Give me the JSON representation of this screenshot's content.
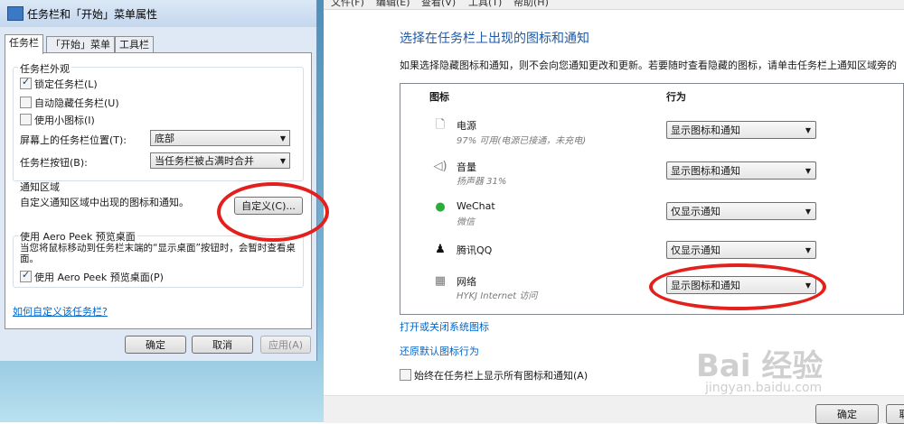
{
  "dialog": {
    "title": "任务栏和「开始」菜单属性",
    "tabs": [
      "任务栏",
      "「开始」菜单",
      "工具栏"
    ],
    "appearance": {
      "title": "任务栏外观",
      "lock": "锁定任务栏(L)",
      "autohide": "自动隐藏任务栏(U)",
      "small_icons": "使用小图标(I)",
      "position_label": "屏幕上的任务栏位置(T):",
      "position_value": "底部",
      "buttons_label": "任务栏按钮(B):",
      "buttons_value": "当任务栏被占满时合并"
    },
    "notify": {
      "title": "通知区域",
      "desc": "自定义通知区域中出现的图标和通知。",
      "customize": "自定义(C)..."
    },
    "peek": {
      "title": "使用 Aero Peek 预览桌面",
      "desc": "当您将鼠标移动到任务栏末端的“显示桌面”按钮时，会暂时查看桌面。",
      "checkbox": "使用 Aero Peek 预览桌面(P)"
    },
    "help_link": "如何自定义该任务栏?",
    "ok": "确定",
    "cancel": "取消",
    "apply": "应用(A)"
  },
  "window": {
    "menu": [
      "文件(F)",
      "编辑(E)",
      "查看(V)",
      "工具(T)",
      "帮助(H)"
    ],
    "heading": "选择在任务栏上出现的图标和通知",
    "desc": "如果选择隐藏图标和通知，则不会向您通知更改和更新。若要随时查看隐藏的图标，请单击任务栏上通知区域旁的",
    "col_icon": "图标",
    "col_behavior": "行为",
    "rows": [
      {
        "icon": "power-icon",
        "name": "电源",
        "sub": "97% 可用(电源已接通，未充电)",
        "value": "显示图标和通知"
      },
      {
        "icon": "volume-icon",
        "name": "音量",
        "sub": "扬声器 31%",
        "value": "显示图标和通知"
      },
      {
        "icon": "wechat-icon",
        "name": "WeChat",
        "sub": "微信",
        "value": "仅显示通知"
      },
      {
        "icon": "qq-icon",
        "name": "腾讯QQ",
        "sub": "",
        "value": "仅显示通知"
      },
      {
        "icon": "network-icon",
        "name": "网络",
        "sub": "HYKJ Internet 访问",
        "value": "显示图标和通知"
      }
    ],
    "link_system_icons": "打开或关闭系统图标",
    "link_restore": "还原默认图标行为",
    "always_show": "始终在任务栏上显示所有图标和通知(A)",
    "ok": "确定",
    "cancel": "取"
  },
  "watermark": {
    "brand": "Bai 经验",
    "url": "jingyan.baidu.com"
  }
}
